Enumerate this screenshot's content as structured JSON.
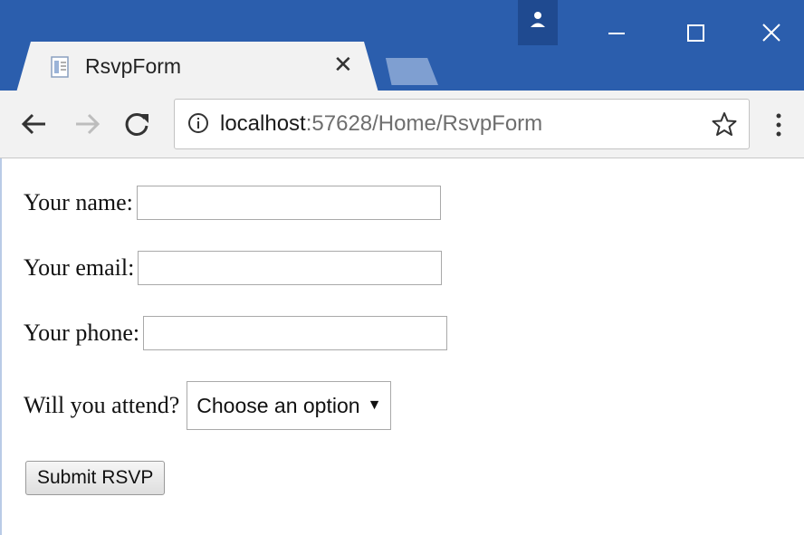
{
  "tab": {
    "title": "RsvpForm",
    "close_glyph": "✕"
  },
  "window_controls": {
    "profile_icon": "person-icon",
    "minimize_icon": "minimize-icon",
    "maximize_icon": "maximize-icon",
    "close_icon": "close-icon"
  },
  "toolbar": {
    "back_icon": "back-arrow-icon",
    "forward_icon": "forward-arrow-icon",
    "reload_icon": "reload-icon",
    "url_host": "localhost",
    "url_rest": ":57628/Home/RsvpForm",
    "bookmark_icon": "star-icon",
    "menu_icon": "kebab-menu-icon"
  },
  "form": {
    "name_label": "Your name:",
    "name_value": "",
    "email_label": "Your email:",
    "email_value": "",
    "phone_label": "Your phone:",
    "phone_value": "",
    "attend_label": "Will you attend?",
    "attend_selected": "Choose an option",
    "submit_label": "Submit RSVP"
  },
  "colors": {
    "titlebar": "#2b5ead",
    "toolbar": "#f2f2f2",
    "content": "#ffffff"
  }
}
